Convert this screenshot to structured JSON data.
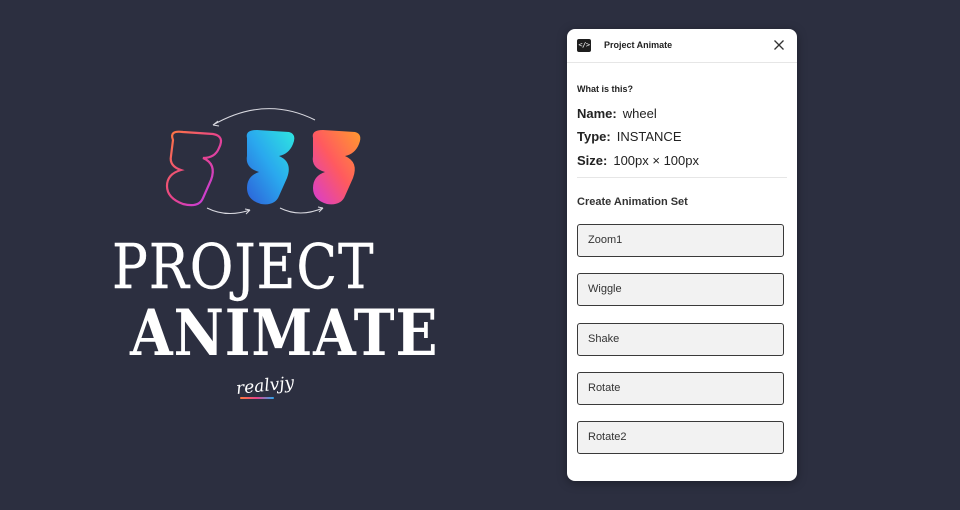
{
  "brand": {
    "line1": "PROJECT",
    "line2": "ANIMATE",
    "signature": "realvjy"
  },
  "panel": {
    "title": "Project Animate",
    "info_heading": "What is this?",
    "name_key": "Name:",
    "name_value": "wheel",
    "type_key": "Type:",
    "type_value": "INSTANCE",
    "size_key": "Size:",
    "size_value": "100px × 100px",
    "animation_heading": "Create Animation Set",
    "animations": [
      "Zoom1",
      "Wiggle",
      "Shake",
      "Rotate",
      "Rotate2"
    ]
  },
  "colors": {
    "background": "#2c2f40",
    "panel": "#ffffff",
    "button_bg": "#f2f2f2",
    "button_border": "#3a3a3a"
  },
  "icons": {
    "app": "code-icon",
    "close": "close-icon"
  }
}
